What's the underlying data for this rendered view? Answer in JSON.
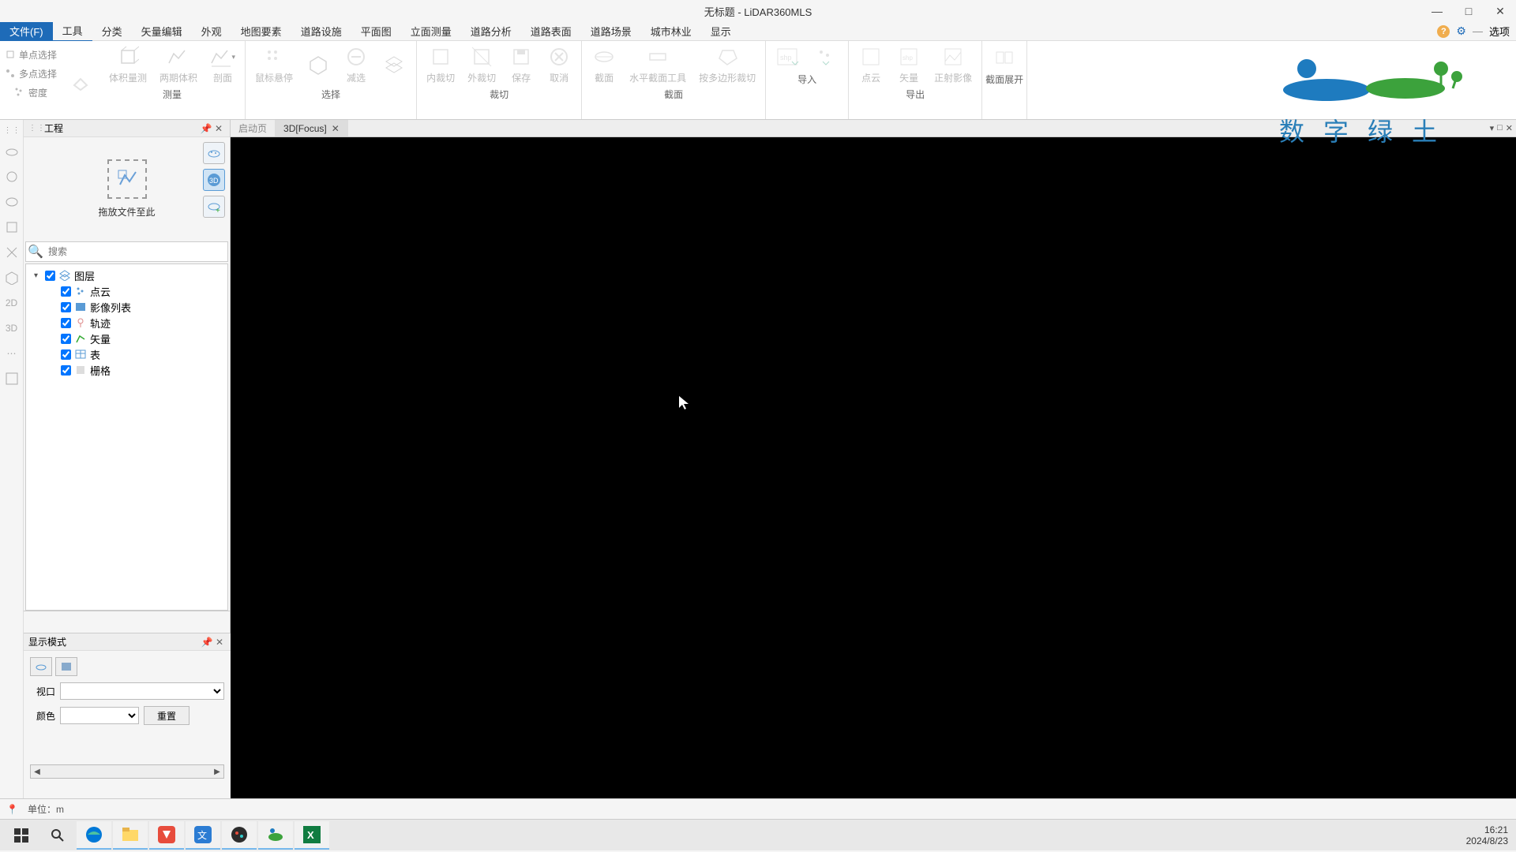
{
  "title": "无标题 - LiDAR360MLS",
  "menu": {
    "file": "文件(F)",
    "items": [
      "工具",
      "分类",
      "矢量编辑",
      "外观",
      "地图要素",
      "道路设施",
      "平面图",
      "立面测量",
      "道路分析",
      "道路表面",
      "道路场景",
      "城市林业",
      "显示"
    ],
    "options": "选项"
  },
  "ribbon": {
    "small_items": [
      "单点选择",
      "多点选择",
      "密度"
    ],
    "groups": {
      "measure": {
        "label": "测量",
        "items": [
          "体积量测",
          "两期体积",
          "剖面"
        ]
      },
      "hover": {
        "label": "选择",
        "items": [
          "鼠标悬停",
          "减选"
        ]
      },
      "hexagon": {
        "items": [
          ""
        ]
      },
      "crop": {
        "label": "裁切",
        "items": [
          "内裁切",
          "外裁切",
          "保存",
          "取消"
        ]
      },
      "section": {
        "label": "截面",
        "items": [
          "截面",
          "水平截面工具",
          "按多边形裁切"
        ]
      },
      "import": {
        "label": "导入",
        "items": [
          "",
          ""
        ]
      },
      "export": {
        "label": "导出",
        "items": [
          "点云",
          "矢量",
          "正射影像"
        ]
      },
      "expand": {
        "label": "截面展开",
        "items": [
          ""
        ]
      }
    }
  },
  "project": {
    "title": "工程",
    "drop_hint": "拖放文件至此",
    "search_placeholder": "搜索",
    "layers_root": "图层",
    "layers": [
      "点云",
      "影像列表",
      "轨迹",
      "矢量",
      "表",
      "栅格"
    ]
  },
  "display_panel": {
    "title": "显示模式",
    "label_viewport": "视口",
    "label_color": "颜色",
    "btn_reset": "重置"
  },
  "tabs": {
    "start": "启动页",
    "view3d": "3D[Focus]"
  },
  "status": {
    "unit": "单位：m"
  },
  "logo_text": "数字绿土",
  "clock": {
    "time": "16:21",
    "date": "2024/8/23"
  }
}
